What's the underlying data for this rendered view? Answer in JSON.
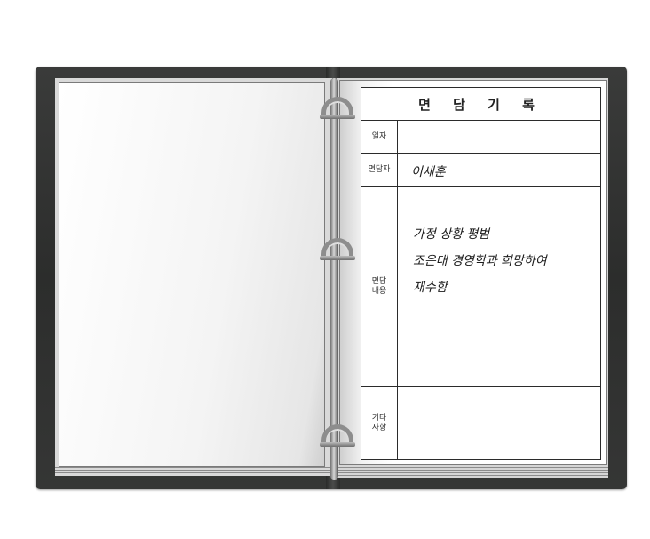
{
  "form": {
    "title": "면 담 기 록",
    "rows": [
      {
        "label": "일자",
        "value": ""
      },
      {
        "label": "면담자",
        "value": "이세훈"
      },
      {
        "label": "면담\n내용",
        "lines": [
          "가정 상황 평범",
          "조은대 경영학과 희망하여",
          "재수함"
        ]
      },
      {
        "label": "기타\n사항",
        "value": ""
      }
    ]
  },
  "icons": [
    "ring-icon"
  ],
  "colors": {
    "binder": "#2f302f",
    "page": "#ffffff",
    "rule": "#2b2b2b"
  }
}
